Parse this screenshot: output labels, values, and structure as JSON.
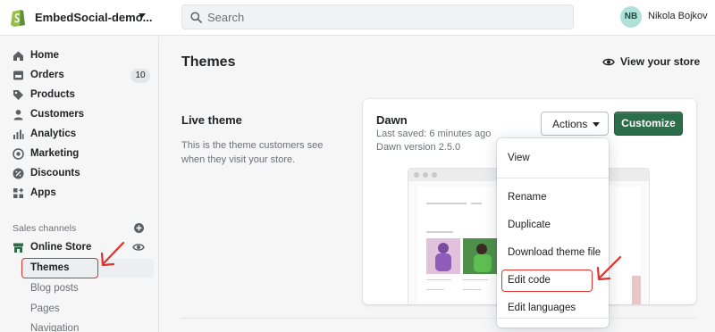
{
  "topbar": {
    "store_name": "EmbedSocial-demo...",
    "search_placeholder": "Search",
    "user_initials": "NB",
    "user_name": "Nikola Bojkov"
  },
  "sidebar": {
    "items": [
      {
        "label": "Home",
        "icon": "home-icon"
      },
      {
        "label": "Orders",
        "icon": "orders-icon",
        "badge": "10"
      },
      {
        "label": "Products",
        "icon": "tag-icon"
      },
      {
        "label": "Customers",
        "icon": "person-icon"
      },
      {
        "label": "Analytics",
        "icon": "bar-chart-icon"
      },
      {
        "label": "Marketing",
        "icon": "target-icon"
      },
      {
        "label": "Discounts",
        "icon": "discount-icon"
      },
      {
        "label": "Apps",
        "icon": "apps-icon"
      }
    ],
    "sales_channels_label": "Sales channels",
    "online_store": "Online Store",
    "sub_items": [
      "Themes",
      "Blog posts",
      "Pages",
      "Navigation"
    ]
  },
  "main": {
    "page_title": "Themes",
    "view_store": "View your store",
    "live_theme_title": "Live theme",
    "live_theme_desc": "This is the theme customers see when they visit your store."
  },
  "theme_card": {
    "name": "Dawn",
    "last_saved": "Last saved: 6 minutes ago",
    "version": "Dawn version 2.5.0",
    "actions_label": "Actions",
    "customize_label": "Customize"
  },
  "dropdown": {
    "items": [
      "View",
      "Rename",
      "Duplicate",
      "Download theme file",
      "Edit code",
      "Edit languages"
    ]
  },
  "colors": {
    "brand_green": "#2c6e49",
    "highlight_red": "#e0312a",
    "shopify_green": "#95bf47"
  }
}
